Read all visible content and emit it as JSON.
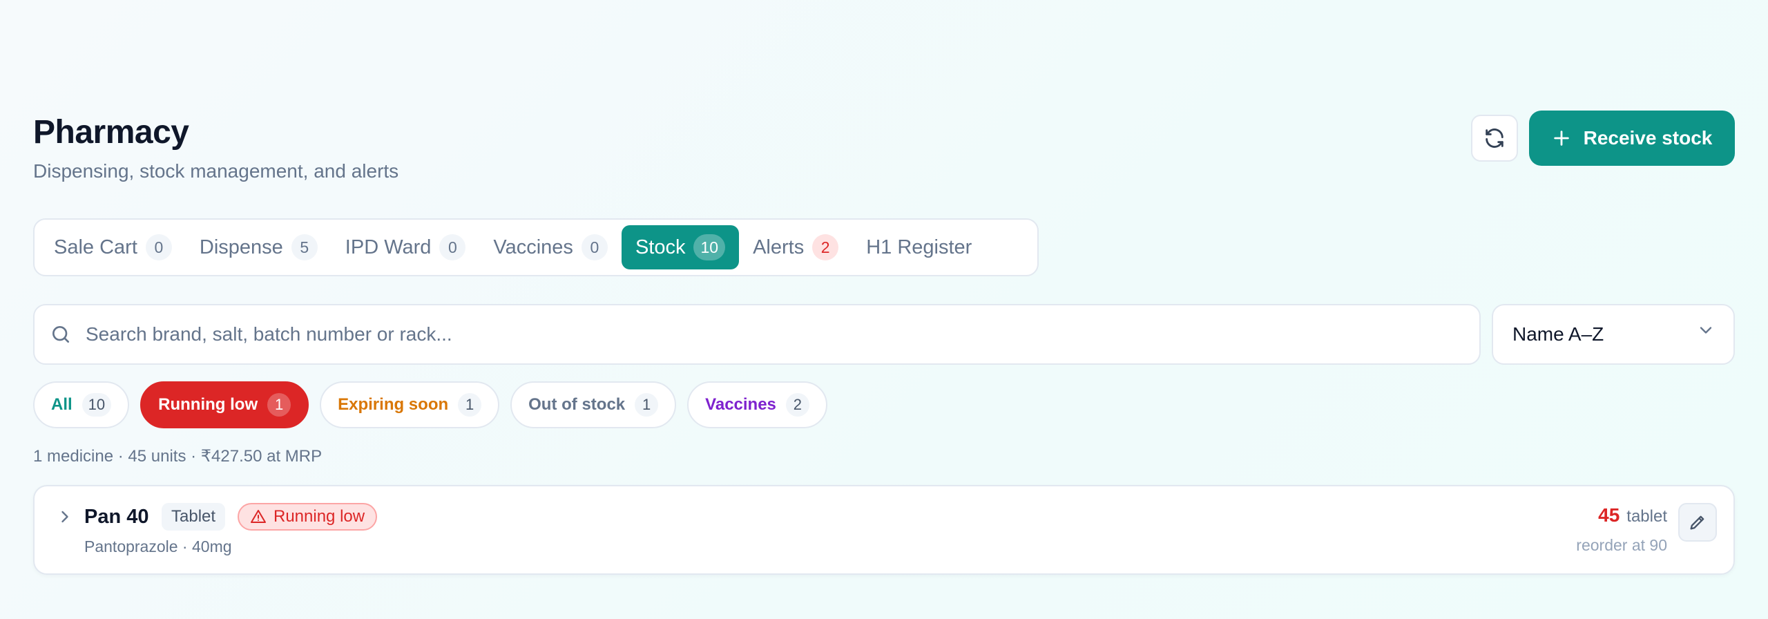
{
  "header": {
    "title": "Pharmacy",
    "subtitle": "Dispensing, stock management, and alerts",
    "refresh_icon": "refresh-icon",
    "receive_label": "Receive stock"
  },
  "tabs": [
    {
      "label": "Sale Cart",
      "count": "0"
    },
    {
      "label": "Dispense",
      "count": "5"
    },
    {
      "label": "IPD Ward",
      "count": "0"
    },
    {
      "label": "Vaccines",
      "count": "0"
    },
    {
      "label": "Stock",
      "count": "10",
      "active": true
    },
    {
      "label": "Alerts",
      "count": "2"
    },
    {
      "label": "H1 Register"
    }
  ],
  "search": {
    "placeholder": "Search brand, salt, batch number or rack...",
    "value": ""
  },
  "sort": {
    "selected": "Name A–Z"
  },
  "filters": [
    {
      "label": "All",
      "count": "10"
    },
    {
      "label": "Running low",
      "count": "1",
      "active": true
    },
    {
      "label": "Expiring soon",
      "count": "1"
    },
    {
      "label": "Out of stock",
      "count": "1"
    },
    {
      "label": "Vaccines",
      "count": "2"
    }
  ],
  "summary": "1 medicine · 45 units · ₹427.50 at MRP",
  "medicines": [
    {
      "name": "Pan 40",
      "form": "Tablet",
      "status": "Running low",
      "salt": "Pantoprazole · 40mg",
      "qty": "45",
      "unit": "tablet",
      "reorder": "reorder at 90"
    }
  ],
  "colors": {
    "accent": "#0d9488",
    "danger": "#dc2626",
    "warning": "#d97706",
    "vaccine": "#7e22ce",
    "muted": "#64748b"
  }
}
